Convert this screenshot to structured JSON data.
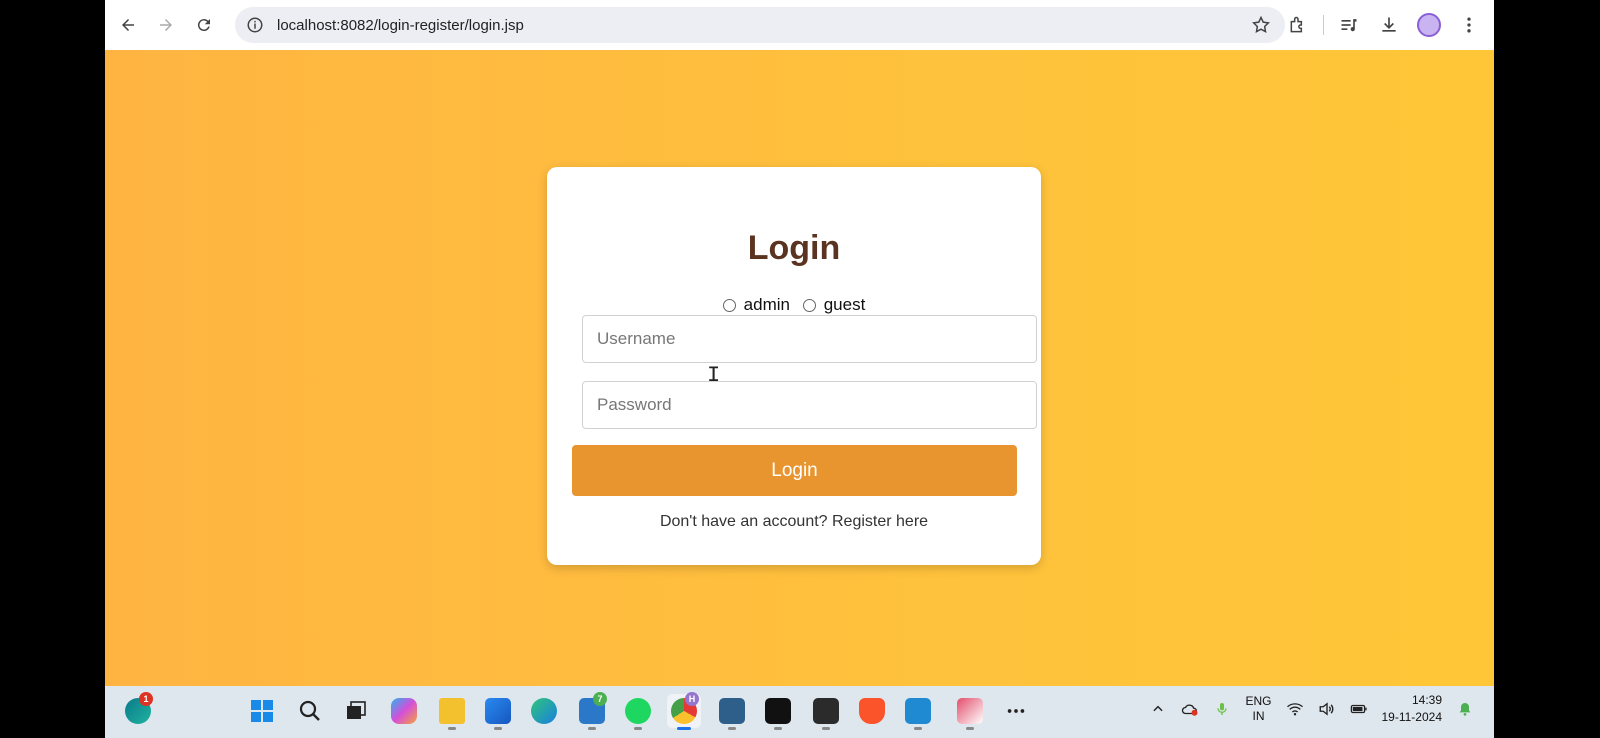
{
  "browser": {
    "url": "localhost:8082/login-register/login.jsp"
  },
  "login": {
    "title": "Login",
    "roles": [
      "admin",
      "guest"
    ],
    "username_placeholder": "Username",
    "password_placeholder": "Password",
    "button_label": "Login",
    "register_text": "Don't have an account? Register here"
  },
  "taskbar": {
    "widget_badge": "1",
    "teams_badge": "7",
    "chrome_badge": "H",
    "lang_line1": "ENG",
    "lang_line2": "IN",
    "time": "14:39",
    "date": "19-11-2024"
  },
  "colors": {
    "page_bg": "#ffc13c",
    "login_button": "#e89530",
    "title": "#5a3420"
  }
}
